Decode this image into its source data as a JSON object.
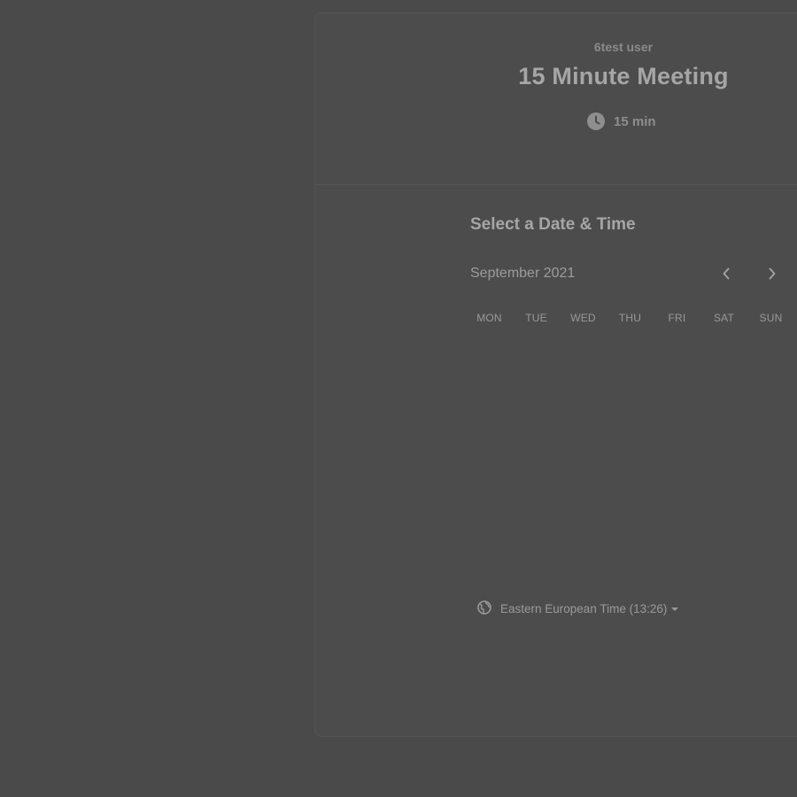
{
  "event": {
    "organizer": "6test user",
    "title": "15 Minute Meeting",
    "duration": "15 min",
    "duration_icon": "clock-icon"
  },
  "calendar": {
    "section_title": "Select a Date & Time",
    "month": "September 2021",
    "prev_icon": "chevron-left-icon",
    "next_icon": "chevron-right-icon",
    "weekdays": [
      "MON",
      "TUE",
      "WED",
      "THU",
      "FRI",
      "SAT",
      "SUN"
    ]
  },
  "timezone": {
    "icon": "globe-icon",
    "label": "Eastern European Time (13:26)",
    "dropdown_icon": "caret-down-icon"
  },
  "colors": {
    "background": "#4a4a4a",
    "card": "#4c4c4c",
    "title_text": "#a6a6a6",
    "muted_text": "#8e8e8e"
  }
}
